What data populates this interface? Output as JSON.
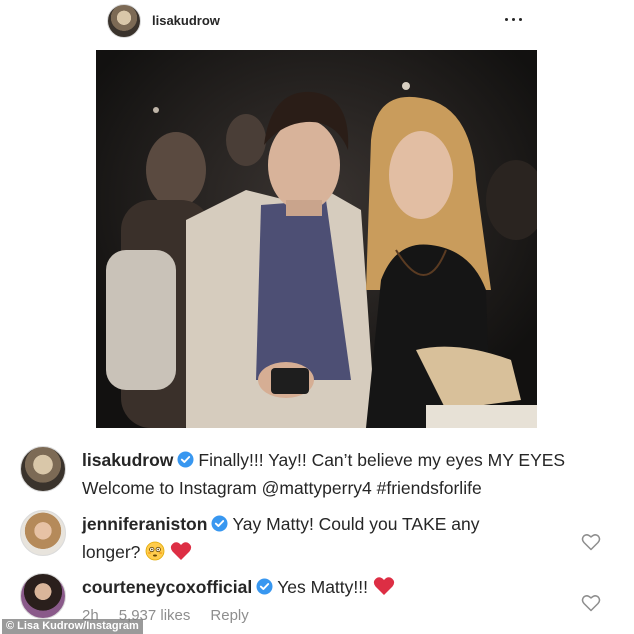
{
  "post": {
    "username": "lisakudrow"
  },
  "comments": [
    {
      "username": "lisakudrow",
      "line1": "Finally!!! Yay!! Can’t believe my eyes MY EYES",
      "line2": "Welcome to Instagram @mattyperry4  #friendsforlife"
    },
    {
      "username": "jenniferaniston",
      "line1": "Yay Matty! Could you TAKE any",
      "line2": "longer?"
    },
    {
      "username": "courteneycoxofficial",
      "line1": "Yes Matty!!!"
    }
  ],
  "meta": {
    "time": "2h",
    "likes": "5,937 likes",
    "reply": "Reply"
  },
  "credit": "© Lisa Kudrow/Instagram",
  "colors": {
    "verified": "#3897f0",
    "heart": "#ed4956",
    "muted": "#8e8e8e"
  },
  "icons": [
    "more-options-icon",
    "verified-badge-icon",
    "heart-outline-icon",
    "red-heart-emoji",
    "flushed-face-emoji"
  ]
}
